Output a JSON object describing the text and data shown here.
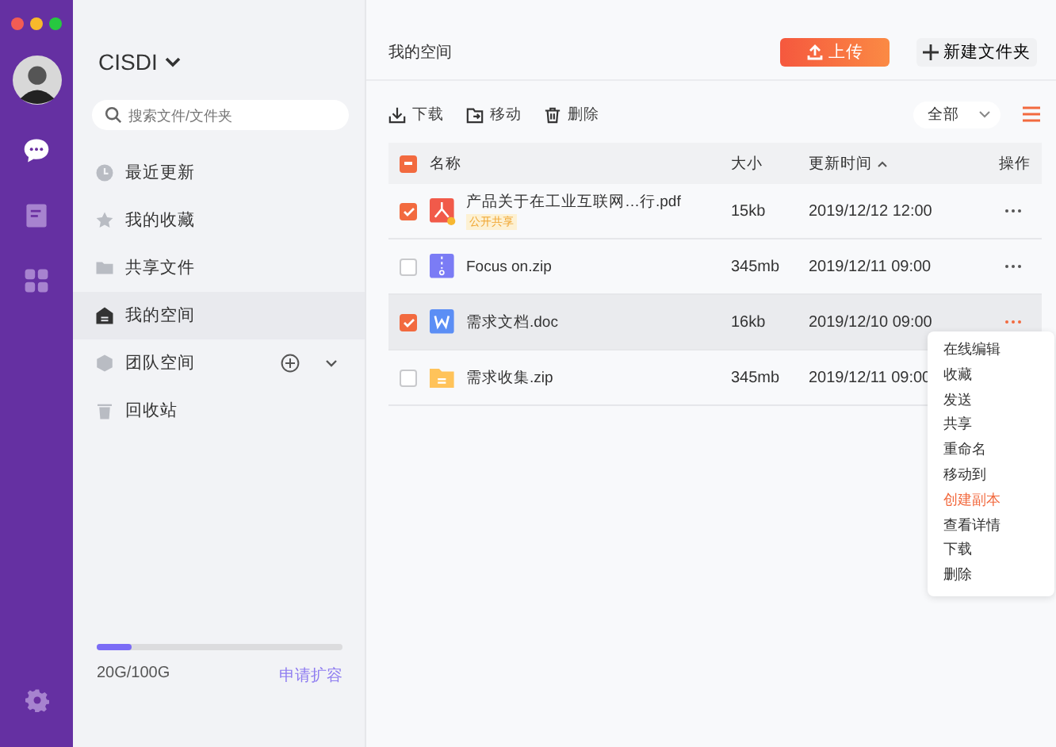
{
  "rail": {
    "items": [
      {
        "kind": "chat",
        "selected": true
      },
      {
        "kind": "book",
        "selected": false
      },
      {
        "kind": "apps",
        "selected": false
      }
    ]
  },
  "sidebar": {
    "org": "CISDI",
    "search": {
      "placeholder": "搜索文件/文件夹"
    },
    "items": [
      {
        "kind": "clock",
        "label": "最近更新",
        "selected": false,
        "expandable": false
      },
      {
        "kind": "star",
        "label": "我的收藏",
        "selected": false,
        "expandable": false
      },
      {
        "kind": "folder",
        "label": "共享文件",
        "selected": false,
        "expandable": false
      },
      {
        "kind": "home",
        "label": "我的空间",
        "selected": true,
        "expandable": false
      },
      {
        "kind": "cube",
        "label": "团队空间",
        "selected": false,
        "expandable": true
      },
      {
        "kind": "trash",
        "label": "回收站",
        "selected": false,
        "expandable": false
      }
    ],
    "storage": {
      "level": 0.14,
      "reading": "20G/100G",
      "link": "申请扩容"
    }
  },
  "main": {
    "title": "我的空间",
    "upload": "上传",
    "new_folder": "新建文件夹",
    "actions": [
      {
        "kind": "download",
        "label": "下载"
      },
      {
        "kind": "move",
        "label": "移动"
      },
      {
        "kind": "delete",
        "label": "删除"
      }
    ],
    "filter": "全部",
    "table": {
      "columns": [
        "名称",
        "大小",
        "更新时间",
        "操作"
      ],
      "partially_checked": true,
      "rows": [
        {
          "kind": "pdf",
          "name": "产品关于在工业互联网…行.pdf",
          "tag": "公开共享",
          "size": "15kb",
          "time": "2019/12/12 12:00",
          "checked": true,
          "active": false
        },
        {
          "kind": "zip",
          "name": "Focus on.zip",
          "size": "345mb",
          "time": "2019/12/11  09:00",
          "checked": false,
          "active": false
        },
        {
          "kind": "doc",
          "name": "需求文档.doc",
          "size": "16kb",
          "time": "2019/12/10  09:00",
          "checked": true,
          "active": true
        },
        {
          "kind": "folder",
          "name": "需求收集.zip",
          "size": "345mb",
          "time": "2019/12/11  09:00",
          "checked": false,
          "active": false
        }
      ]
    },
    "menu": [
      {
        "label": "在线编辑",
        "selected": false
      },
      {
        "label": "收藏",
        "selected": false
      },
      {
        "label": "发送",
        "selected": false
      },
      {
        "label": "共享",
        "selected": false
      },
      {
        "label": "重命名",
        "selected": false
      },
      {
        "label": "移动到",
        "selected": false
      },
      {
        "label": "创建副本",
        "selected": true
      },
      {
        "label": "查看详情",
        "selected": false
      },
      {
        "label": "下载",
        "selected": false
      },
      {
        "label": "删除",
        "selected": false
      }
    ]
  }
}
